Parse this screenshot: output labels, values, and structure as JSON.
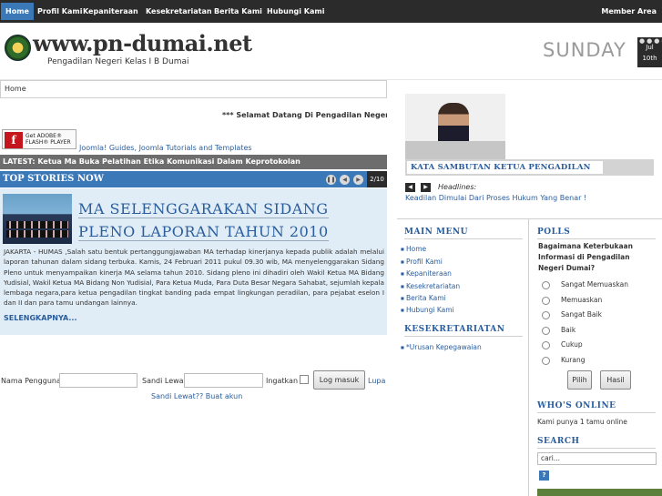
{
  "nav": {
    "items": [
      "Home",
      "Profil Kami",
      "Kepaniteraan",
      "Kesekretariatan",
      "Berita Kami",
      "Hubungi Kami"
    ],
    "member": "Member Area"
  },
  "header": {
    "title": "www.pn-dumai.net",
    "subtitle": "Pengadilan Negeri Kelas I B Dumai",
    "day": "SUNDAY",
    "month": "Jul",
    "date": "10th"
  },
  "breadcrumb": "Home",
  "marquee": "*** Selamat Datang Di Pengadilan Negeri Kelas",
  "flash": {
    "line1": "Get ADOBE®",
    "line2": "FLASH® PLAYER"
  },
  "joomla_link": "Joomla! Guides, Joomla Tutorials and Templates",
  "latest": {
    "label": "LATEST:",
    "text": "Ketua Ma Buka Pelatihan Etika Komunikasi Dalam Keprotokolan"
  },
  "top_stories": {
    "title": "TOP STORIES NOW",
    "pager": "2/10"
  },
  "story": {
    "title_line1": "MA SELENGGARAKAN SIDANG",
    "title_line2": "PLENO LAPORAN TAHUN 2010",
    "body": "JAKARTA - HUMAS ,Salah satu bentuk pertanggungjawaban MA terhadap kinerjanya kepada publik adalah melalui laporan tahunan dalam sidang terbuka. Kamis, 24 Februari 2011 pukul 09.30 wib, MA menyelenggarakan Sidang Pleno untuk menyampaikan kinerja MA selama tahun 2010. Sidang pleno ini dihadiri oleh Wakil Ketua MA Bidang Yudisial, Wakil Ketua MA Bidang Non Yudisial, Para Ketua Muda, Para Duta Besar Negara Sahabat, sejumlah kepala lembaga negara,para ketua pengadilan tingkat banding pada empat lingkungan peradilan, para pejabat eselon I dan II dan para tamu undangan lainnya.",
    "readmore": "SELENGKAPNYA..."
  },
  "login": {
    "username_label": "Nama Pengguna",
    "password_label": "Sandi Lewat",
    "remember_label": "Ingatkan",
    "button": "Log masuk",
    "forgot": "Lupa",
    "forgot2": "Sandi Lewat?? Buat akun"
  },
  "sambutan": "KATA SAMBUTAN KETUA PENGADILAN",
  "headlines": {
    "label": "Headlines:",
    "link": "Keadilan Dimulai Dari Proses Hukum Yang Benar !"
  },
  "main_menu": {
    "title": "MAIN MENU",
    "items": [
      "Home",
      "Profil Kami",
      "Kepaniteraan",
      "Kesekretariatan",
      "Berita Kami",
      "Hubungi Kami"
    ]
  },
  "kesekretariatan": {
    "title": "KESEKRETARIATAN",
    "items": [
      "*Urusan Kepegawaian"
    ]
  },
  "polls": {
    "title": "POLLS",
    "question": "Bagaimana Keterbukaan Informasi di Pengadilan Negeri Dumai?",
    "options": [
      "Sangat Memuaskan",
      "Memuaskan",
      "Sangat Baik",
      "Baik",
      "Cukup",
      "Kurang"
    ],
    "vote": "Pilih",
    "results": "Hasil"
  },
  "whos_online": {
    "title": "WHO'S ONLINE",
    "text": "Kami punya 1 tamu online"
  },
  "search": {
    "title": "SEARCH",
    "value": "cari..."
  },
  "colors": {
    "accent": "#3b78b8",
    "link": "#2a5d9c",
    "nav_bg": "#2b2b2b"
  }
}
